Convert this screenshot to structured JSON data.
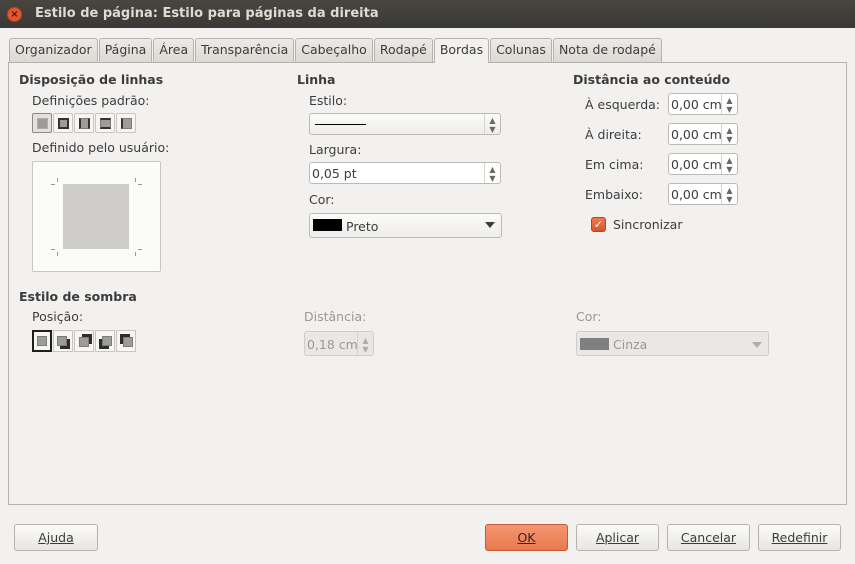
{
  "window": {
    "title": "Estilo de página: Estilo para páginas da direita",
    "close_glyph": "×"
  },
  "tabs": [
    {
      "label": "Organizador"
    },
    {
      "label": "Página"
    },
    {
      "label": "Área"
    },
    {
      "label": "Transparência"
    },
    {
      "label": "Cabeçalho"
    },
    {
      "label": "Rodapé"
    },
    {
      "label": "Bordas",
      "active": true
    },
    {
      "label": "Colunas"
    },
    {
      "label": "Nota de rodapé"
    }
  ],
  "line_arrangement": {
    "heading": "Disposição de linhas",
    "presets_label": "Definições padrão:",
    "presets": [
      "none",
      "all",
      "left-right",
      "top-bottom",
      "left"
    ],
    "user_defined_label": "Definido pelo usuário:"
  },
  "line": {
    "heading": "Linha",
    "style_label": "Estilo:",
    "width_label": "Largura:",
    "width_value": "0,05 pt",
    "color_label": "Cor:",
    "color_value": "Preto",
    "color_hex": "#000000"
  },
  "spacing": {
    "heading": "Distância ao conteúdo",
    "rows": [
      {
        "label": "À esquerda:",
        "value": "0,00 cm"
      },
      {
        "label": "À direita:",
        "value": "0,00 cm"
      },
      {
        "label": "Em cima:",
        "value": "0,00 cm"
      },
      {
        "label": "Embaixo:",
        "value": "0,00 cm"
      }
    ],
    "sync_label": "Sincronizar",
    "sync_checked": true
  },
  "shadow": {
    "heading": "Estilo de sombra",
    "position_label": "Posição:",
    "positions": [
      "none",
      "bottom-right",
      "top-right",
      "bottom-left",
      "top-left"
    ],
    "distance_label": "Distância:",
    "distance_value": "0,18 cm",
    "color_label": "Cor:",
    "color_value": "Cinza",
    "color_hex": "#808080"
  },
  "buttons": {
    "help": "Ajuda",
    "ok": "OK",
    "apply": "Aplicar",
    "cancel": "Cancelar",
    "reset": "Redefinir"
  },
  "accent_color": "#e9794f"
}
